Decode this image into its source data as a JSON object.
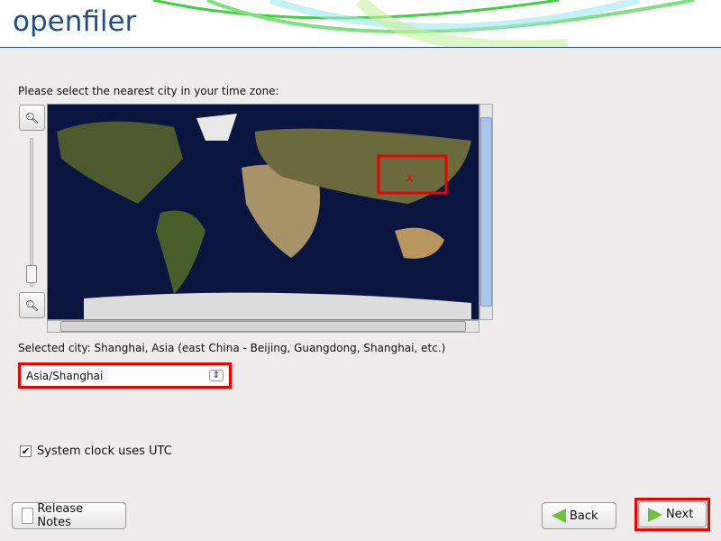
{
  "header": {
    "logo": "openfiler"
  },
  "prompt": "Please select the nearest city in your time zone:",
  "map": {
    "selected_marker": "x"
  },
  "selected_city": "Selected city: Shanghai, Asia (east China - Beijing, Guangdong, Shanghai, etc.)",
  "timezone_select": {
    "value": "Asia/Shanghai"
  },
  "utc_checkbox": {
    "label": "System clock uses UTC",
    "checked": true
  },
  "buttons": {
    "release_notes": "Release Notes",
    "back": "Back",
    "next": "Next"
  },
  "colors": {
    "brand": "#1d4f86",
    "highlight": "#e00000"
  }
}
